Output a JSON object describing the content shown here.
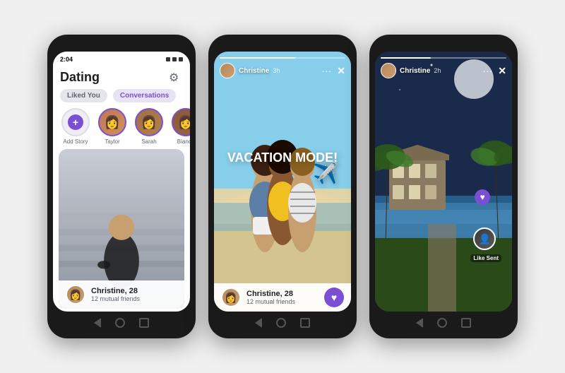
{
  "phones": [
    {
      "id": "phone1",
      "type": "dating-home",
      "status_bar": {
        "time": "2:04",
        "icons": [
          "signal",
          "wifi",
          "battery"
        ]
      },
      "header": {
        "title": "Dating",
        "settings_icon": "⚙"
      },
      "tabs": [
        {
          "id": "liked-you",
          "label": "Liked You",
          "active": false
        },
        {
          "id": "conversations",
          "label": "Conversations",
          "active": true
        }
      ],
      "stories": [
        {
          "id": "add",
          "label": "Add Story",
          "type": "add"
        },
        {
          "id": "taylor",
          "label": "Taylor",
          "color": "#c07850"
        },
        {
          "id": "sarah",
          "label": "Sarah",
          "color": "#a06840"
        },
        {
          "id": "bianca",
          "label": "Bianca",
          "color": "#8a5835"
        }
      ],
      "card": {
        "name": "Christine, 28",
        "sub": "12 mutual friends"
      }
    },
    {
      "id": "phone2",
      "type": "story-view",
      "story": {
        "username": "Christine",
        "time": "3h",
        "text": "VACATION MODE!",
        "emoji": "✈️",
        "progress": 60
      },
      "card": {
        "name": "Christine, 28",
        "sub": "12 mutual friends"
      }
    },
    {
      "id": "phone3",
      "type": "story-resort",
      "story": {
        "username": "Christine",
        "time": "2h"
      },
      "like_sent": {
        "label": "Like Sent"
      }
    }
  ],
  "nav_buttons": {
    "back": "◁",
    "home": "□",
    "circle": ""
  }
}
